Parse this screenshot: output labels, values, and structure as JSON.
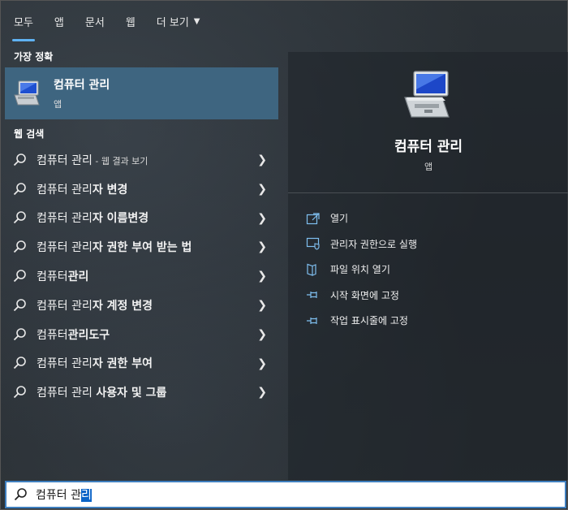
{
  "tabs": [
    {
      "label": "모두",
      "active": true
    },
    {
      "label": "앱"
    },
    {
      "label": "문서"
    },
    {
      "label": "웹"
    },
    {
      "label": "더 보기"
    }
  ],
  "best_match": {
    "section": "가장 정확",
    "title": "컴퓨터 관리",
    "subtitle": "앱"
  },
  "web_search": {
    "section": "웹 검색",
    "items": [
      {
        "prefix": "컴퓨터 관리",
        "suffix": "",
        "small": " - 웹 결과 보기"
      },
      {
        "prefix": "컴퓨터 관리",
        "suffix": "자 변경"
      },
      {
        "prefix": "컴퓨터 관리",
        "suffix": "자 이름변경"
      },
      {
        "prefix": "컴퓨터 관리",
        "suffix": "자 권한 부여 받는 법"
      },
      {
        "prefix": "컴퓨터",
        "suffix": "관리"
      },
      {
        "prefix": "컴퓨터 관리",
        "suffix": "자 계정 변경"
      },
      {
        "prefix": "컴퓨터",
        "suffix": "관리도구"
      },
      {
        "prefix": "컴퓨터 관리",
        "suffix": "자 권한 부여"
      },
      {
        "prefix": "컴퓨터 관리 ",
        "suffix": "사용자 및 그룹"
      }
    ]
  },
  "preview": {
    "title": "컴퓨터 관리",
    "subtitle": "앱",
    "actions": [
      {
        "label": "열기",
        "icon": "open-icon"
      },
      {
        "label": "관리자 권한으로 실행",
        "icon": "shield-run-icon"
      },
      {
        "label": "파일 위치 열기",
        "icon": "folder-icon"
      },
      {
        "label": "시작 화면에 고정",
        "icon": "pin-icon"
      },
      {
        "label": "작업 표시줄에 고정",
        "icon": "pin-icon"
      }
    ]
  },
  "search": {
    "typed": "컴퓨터 관",
    "selected": "리"
  },
  "colors": {
    "accent": "#5fb2f2",
    "selected_row": "#3e6580",
    "search_selection": "#0a64c8"
  }
}
